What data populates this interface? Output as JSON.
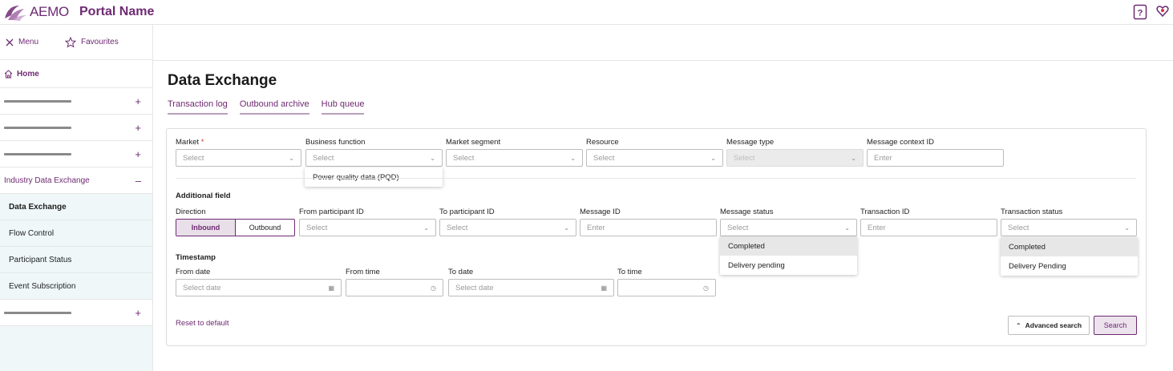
{
  "brand": {
    "logo_text": "AEMO",
    "portal_name": "Portal Name",
    "accent": "#6e2a72"
  },
  "header": {
    "help_icon": "help-question-icon",
    "user_icon": "user-heart-icon"
  },
  "sidebar": {
    "menu_label": "Menu",
    "favourites_label": "Favourites",
    "home_label": "Home",
    "section_label": "Industry Data Exchange",
    "sub_items": [
      {
        "label": "Data Exchange"
      },
      {
        "label": "Flow Control"
      },
      {
        "label": "Participant Status"
      },
      {
        "label": "Event Subscription"
      }
    ]
  },
  "main": {
    "title": "Data Exchange",
    "tabs": [
      {
        "label": "Transaction log"
      },
      {
        "label": "Outbound archive"
      },
      {
        "label": "Hub queue"
      }
    ]
  },
  "filters": {
    "market": {
      "label": "Market",
      "required_mark": "*",
      "placeholder": "Select"
    },
    "business_function": {
      "label": "Business function",
      "placeholder": "Select",
      "options": [
        "Power quality data (PQD)"
      ]
    },
    "market_segment": {
      "label": "Market segment",
      "placeholder": "Select"
    },
    "resource": {
      "label": "Resource",
      "placeholder": "Select"
    },
    "message_type": {
      "label": "Message type",
      "placeholder": "Select"
    },
    "message_context_id": {
      "label": "Message context ID",
      "placeholder": "Enter"
    },
    "additional_field_title": "Additional field",
    "direction": {
      "label": "Direction",
      "options": [
        "Inbound",
        "Outbound"
      ],
      "selected": "Inbound"
    },
    "from_participant_id": {
      "label": "From participant ID",
      "placeholder": "Select"
    },
    "to_participant_id": {
      "label": "To participant ID",
      "placeholder": "Select"
    },
    "message_id": {
      "label": "Message ID",
      "placeholder": "Enter"
    },
    "message_status": {
      "label": "Message status",
      "placeholder": "Select",
      "options": [
        "Completed",
        "Delivery pending"
      ]
    },
    "transaction_id": {
      "label": "Transaction ID",
      "placeholder": "Enter"
    },
    "transaction_status": {
      "label": "Transaction status",
      "placeholder": "Select",
      "options": [
        "Completed",
        "Delivery Pending"
      ]
    },
    "timestamp_title": "Timestamp",
    "from_date": {
      "label": "From date",
      "placeholder": "Select date"
    },
    "from_time": {
      "label": "From time",
      "placeholder": ""
    },
    "to_date": {
      "label": "To date",
      "placeholder": "Select date"
    },
    "to_time": {
      "label": "To time",
      "placeholder": ""
    }
  },
  "actions": {
    "reset_label": "Reset to default",
    "advanced_label": "Advanced search",
    "search_label": "Search"
  }
}
